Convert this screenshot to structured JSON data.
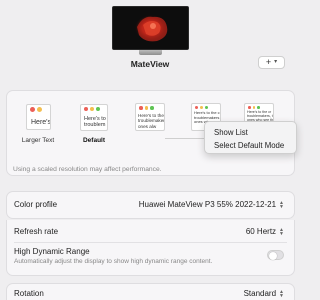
{
  "display": {
    "name": "MateView",
    "add_button_label": "+",
    "add_button_chevron": "▾"
  },
  "resolutions": [
    {
      "label": "Larger Text",
      "preview_text": "Here's",
      "selected": false
    },
    {
      "label": "Default",
      "preview_text": "Here's to\ntroublem",
      "selected": true
    },
    {
      "label": "",
      "preview_text": "Here's to the\ntroublemakers\nones alw",
      "selected": false
    },
    {
      "label": "",
      "preview_text": "Here's to the c\ntroublemakers\nones who see t",
      "selected": false
    },
    {
      "label": "",
      "preview_text": "Here's to the cr\ntroublemakers, th\nones who see thi",
      "selected": false
    }
  ],
  "scaled_note": "Using a scaled resolution may affect performance.",
  "context_menu": {
    "items": [
      "Show List",
      "Select Default Mode"
    ]
  },
  "settings": {
    "color_profile": {
      "label": "Color profile",
      "value": "Huawei MateView P3 55% 2022-12-21"
    },
    "refresh_rate": {
      "label": "Refresh rate",
      "value": "60 Hertz"
    },
    "hdr": {
      "label": "High Dynamic Range",
      "description": "Automatically adjust the display to show high dynamic range content.",
      "enabled": false
    },
    "rotation": {
      "label": "Rotation",
      "value": "Standard"
    }
  },
  "colors": {
    "traffic_red": "#ec5f57",
    "traffic_yellow": "#f3be4f",
    "traffic_green": "#5fc454",
    "wallpaper_red": "#c8281c"
  },
  "icons": {
    "updown": "updown-chevron-icon",
    "add": "plus-icon"
  }
}
